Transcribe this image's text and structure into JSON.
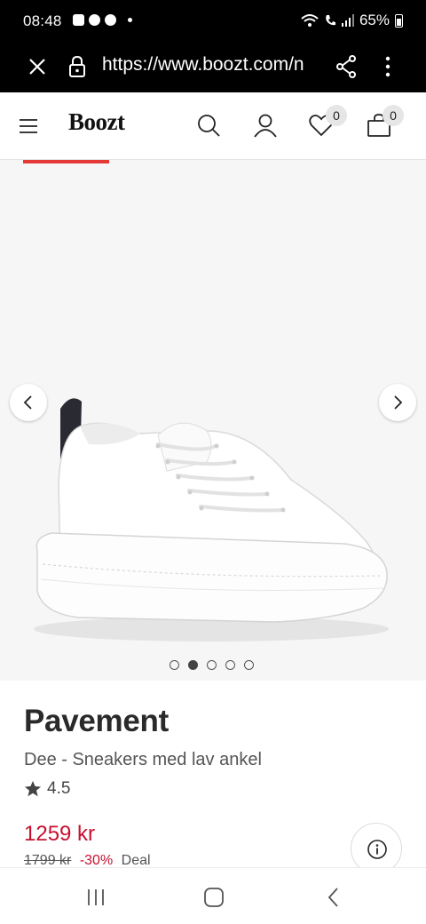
{
  "status_bar": {
    "time": "08:48",
    "battery": "65%",
    "icons": [
      "gallery-icon",
      "messenger-icon",
      "messenger-icon",
      "notification-dot",
      "wifi-icon",
      "call-icon",
      "signal-icon",
      "battery-icon"
    ]
  },
  "browser": {
    "url": "https://www.boozt.com/n",
    "icons": [
      "close-icon",
      "lock-icon",
      "share-icon",
      "more-icon"
    ]
  },
  "header": {
    "logo": "Boozt",
    "wishlist_count": "0",
    "cart_count": "0",
    "icons": [
      "menu-icon",
      "search-icon",
      "account-icon",
      "heart-icon",
      "bag-icon"
    ]
  },
  "gallery": {
    "image_count": 5,
    "active_index": 1,
    "accent_color": "#e53935"
  },
  "product": {
    "brand": "Pavement",
    "name": "Dee - Sneakers med lav ankel",
    "rating": "4.5",
    "price": "1259 kr",
    "old_price": "1799 kr",
    "discount": "-30%",
    "deal_label": "Deal",
    "price_color": "#c8102e"
  },
  "nav_bar": {
    "icons": [
      "recents-icon",
      "home-icon",
      "back-icon"
    ]
  }
}
